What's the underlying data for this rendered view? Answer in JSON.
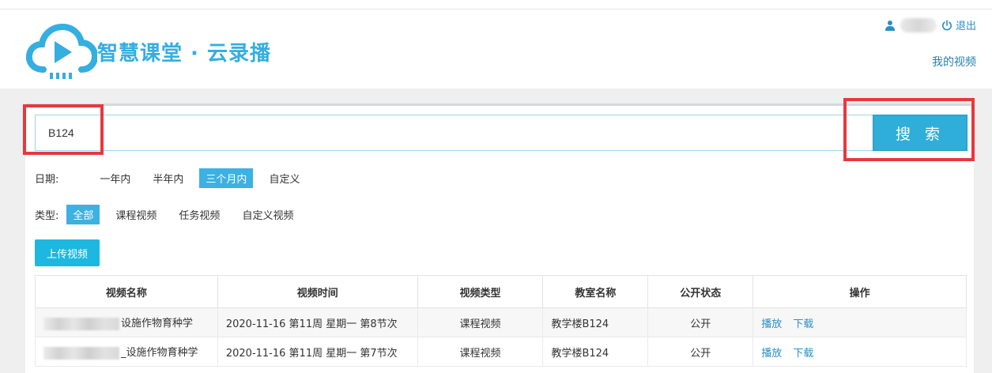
{
  "brand": {
    "title": "智慧课堂 · 云录播"
  },
  "user_bar": {
    "logout_label": "退出",
    "my_videos_label": "我的视频"
  },
  "search": {
    "value": "B124",
    "button_label": "搜 索"
  },
  "filters": {
    "date": {
      "label": "日期:",
      "options": [
        "一年内",
        "半年内",
        "三个月内",
        "自定义"
      ],
      "selected": "三个月内"
    },
    "type": {
      "label": "类型:",
      "options": [
        "全部",
        "课程视频",
        "任务视频",
        "自定义视频"
      ],
      "selected": "全部"
    }
  },
  "upload_label": "上传视频",
  "table": {
    "headers": [
      "视频名称",
      "视频时间",
      "视频类型",
      "教室名称",
      "公开状态",
      "操作"
    ],
    "rows": [
      {
        "name": "设施作物育种学",
        "time": "2020-11-16 第11周 星期一 第8节次",
        "type": "课程视频",
        "room": "教学楼B124",
        "status": "公开",
        "play": "播放",
        "download": "下载"
      },
      {
        "name": "_设施作物育种学",
        "time": "2020-11-16 第11周 星期一 第7节次",
        "type": "课程视频",
        "room": "教学楼B124",
        "status": "公开",
        "play": "播放",
        "download": "下载"
      }
    ]
  },
  "colors": {
    "accent": "#2eaed9",
    "highlight": "#e8383d",
    "link": "#2a8fc2"
  }
}
